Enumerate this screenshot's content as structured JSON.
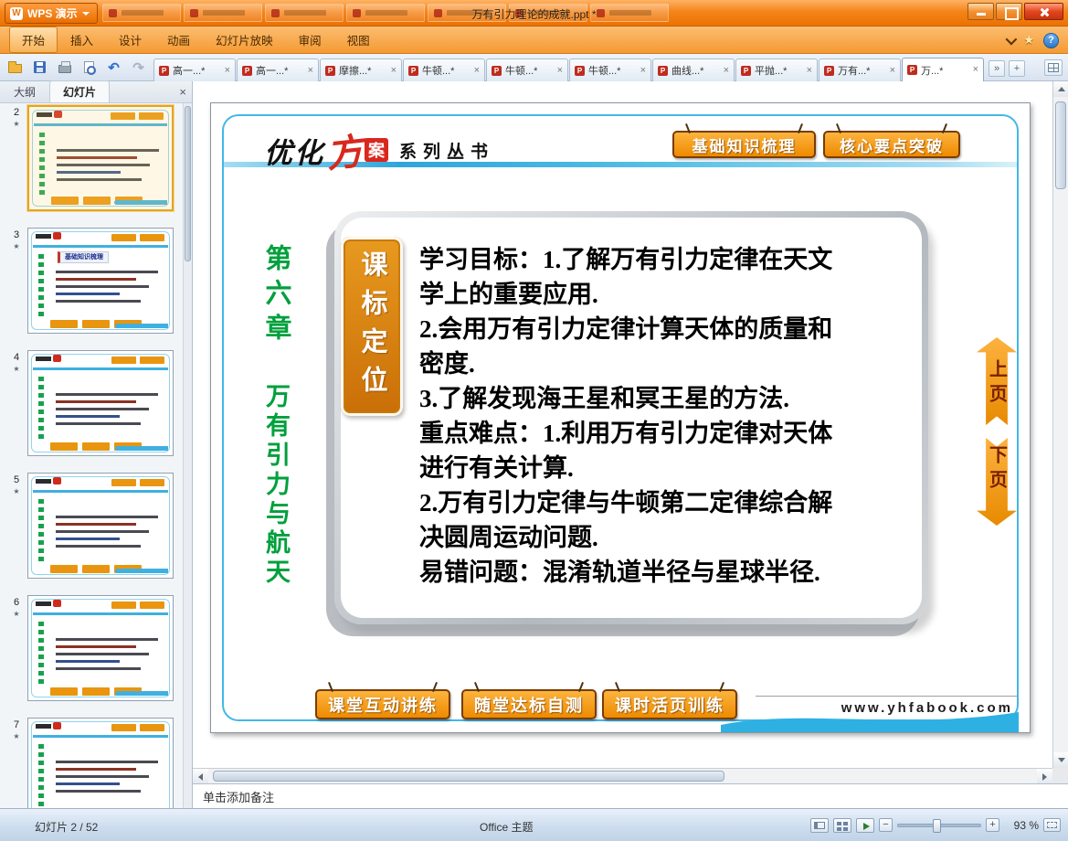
{
  "glyphs": {
    "wps": "W",
    "star": "★",
    "help": "?",
    "undo": "↶",
    "redo": "↷",
    "overflow": "»",
    "new_tab": "+",
    "close_tab": "×",
    "panel_close": "×",
    "transition_star": "★",
    "minus": "−",
    "plus": "+"
  },
  "window": {
    "app_button": "WPS 演示",
    "title": "万有引力理论的成就.ppt *"
  },
  "menu_bar": {
    "items": [
      "开始",
      "插入",
      "设计",
      "动画",
      "幻灯片放映",
      "审阅",
      "视图"
    ]
  },
  "doc_tabs": {
    "tabs": [
      {
        "label": "高一...*"
      },
      {
        "label": "高一...*"
      },
      {
        "label": "摩擦...*"
      },
      {
        "label": "牛顿...*"
      },
      {
        "label": "牛顿...*"
      },
      {
        "label": "牛顿...*"
      },
      {
        "label": "曲线...*"
      },
      {
        "label": "平抛...*"
      },
      {
        "label": "万有...*"
      },
      {
        "label": "万...*"
      }
    ]
  },
  "slide_panel": {
    "tabs": [
      "大纲",
      "幻灯片"
    ],
    "thumbnails": [
      {
        "number": "2",
        "mini_title": ""
      },
      {
        "number": "3",
        "mini_title": "基础知识梳理"
      },
      {
        "number": "4",
        "mini_title": ""
      },
      {
        "number": "5",
        "mini_title": ""
      },
      {
        "number": "6",
        "mini_title": ""
      },
      {
        "number": "7",
        "mini_title": ""
      }
    ]
  },
  "slide": {
    "logo": {
      "part1": "优化",
      "part2": "方",
      "part3": "案",
      "series": "系列丛书"
    },
    "top_buttons": [
      "基础知识梳理",
      "核心要点突破"
    ],
    "chapter": "第六章",
    "book_title": "万有引力与航天",
    "side_tab": "课标定位",
    "content_lines": [
      "学习目标：1.了解万有引力定律在天文",
      "学上的重要应用.",
      "2.会用万有引力定律计算天体的质量和",
      "密度.",
      "3.了解发现海王星和冥王星的方法.",
      "重点难点：1.利用万有引力定律对天体",
      "进行有关计算.",
      "2.万有引力定律与牛顿第二定律综合解",
      "决圆周运动问题.",
      "易错问题：混淆轨道半径与星球半径."
    ],
    "nav_up": "上页",
    "nav_down": "下页",
    "bottom_buttons": [
      "课堂互动讲练",
      "随堂达标自测",
      "课时活页训练"
    ],
    "website": "www.yhfabook.com"
  },
  "notes": {
    "placeholder": "单击添加备注"
  },
  "status_bar": {
    "slide_info": "幻灯片 2 / 52",
    "theme": "Office 主题",
    "zoom": "93 %"
  }
}
